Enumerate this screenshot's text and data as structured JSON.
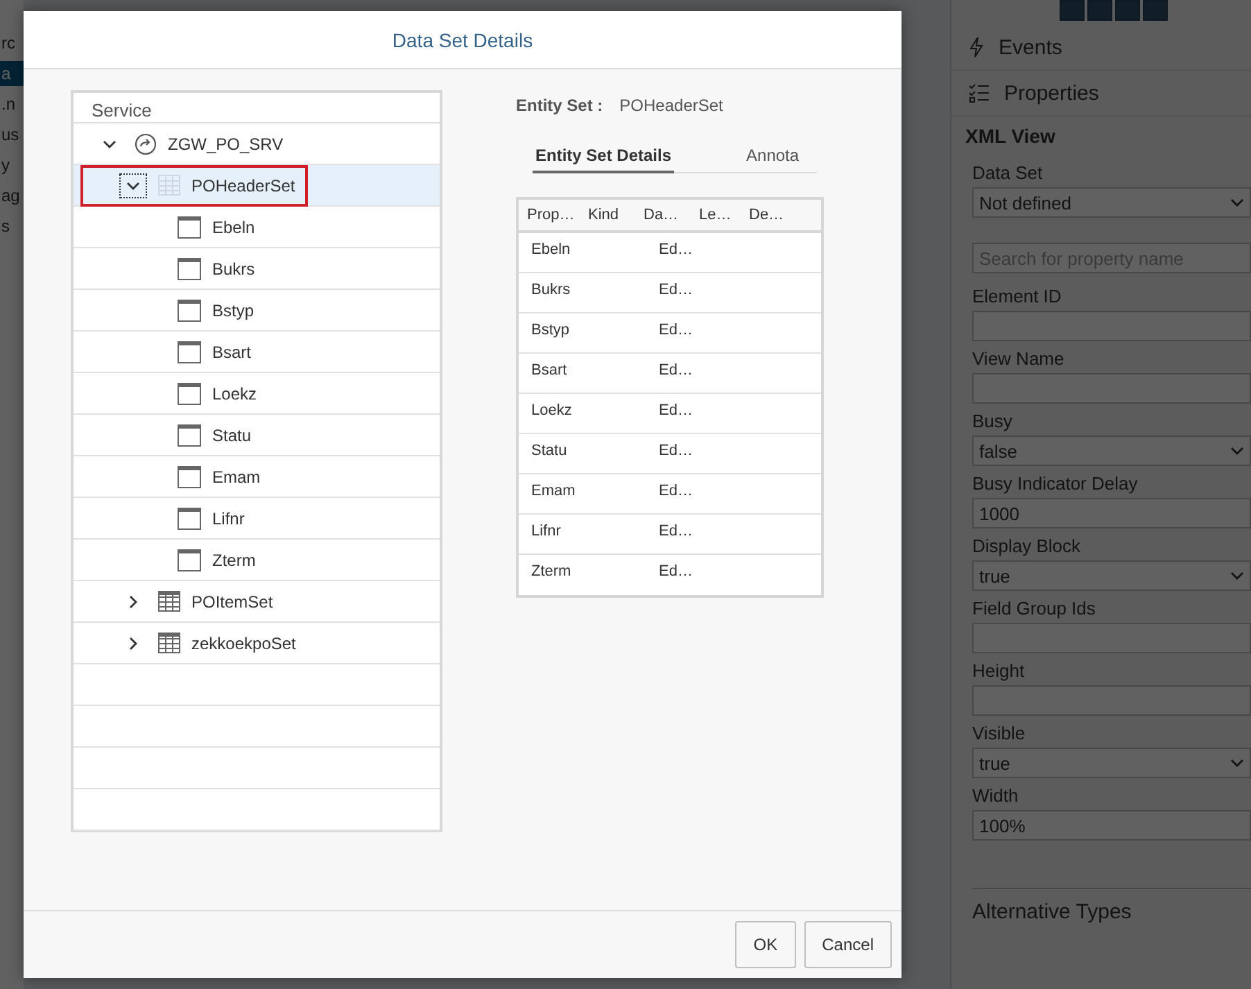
{
  "background": {
    "sidebar_fragments": [
      {
        "text": "rc",
        "selected": false
      },
      {
        "text": "a",
        "selected": true
      },
      {
        "text": ".n",
        "selected": false
      },
      {
        "text": "us",
        "selected": false
      },
      {
        "text": "y",
        "selected": false
      },
      {
        "text": "ag",
        "selected": false
      },
      {
        "text": "s",
        "selected": false
      }
    ],
    "panel": {
      "sections": [
        {
          "label": "Events",
          "kind": "events"
        },
        {
          "label": "Properties",
          "kind": "properties"
        }
      ],
      "heading": "XML View",
      "fields": [
        {
          "kind": "select",
          "label": "Data Set",
          "value": "Not defined"
        },
        {
          "kind": "search",
          "placeholder": "Search for property name"
        },
        {
          "kind": "input",
          "label": "Element ID"
        },
        {
          "kind": "input",
          "label": "View Name"
        },
        {
          "kind": "select",
          "label": "Busy",
          "value": "false"
        },
        {
          "kind": "input",
          "label": "Busy Indicator Delay",
          "value": "1000"
        },
        {
          "kind": "select",
          "label": "Display Block",
          "value": "true"
        },
        {
          "kind": "input",
          "label": "Field Group Ids"
        },
        {
          "kind": "input",
          "label": "Height"
        },
        {
          "kind": "select",
          "label": "Visible",
          "value": "true"
        },
        {
          "kind": "input",
          "label": "Width",
          "value": "100%"
        }
      ],
      "footer_section": "Alternative Types"
    }
  },
  "dialog": {
    "title": "Data Set Details",
    "tree": {
      "header": "Service",
      "nodes": [
        {
          "label": "ZGW_PO_SRV",
          "kind": "service",
          "expanded": true,
          "selected": false,
          "marked": false,
          "children": [
            {
              "label": "POHeaderSet",
              "kind": "entity_set",
              "expanded": true,
              "selected": true,
              "marked": true,
              "children": [
                {
                  "label": "Ebeln",
                  "kind": "property",
                  "selected": false,
                  "marked": false
                },
                {
                  "label": "Bukrs",
                  "kind": "property",
                  "selected": false,
                  "marked": false
                },
                {
                  "label": "Bstyp",
                  "kind": "property",
                  "selected": false,
                  "marked": false
                },
                {
                  "label": "Bsart",
                  "kind": "property",
                  "selected": false,
                  "marked": false
                },
                {
                  "label": "Loekz",
                  "kind": "property",
                  "selected": false,
                  "marked": false
                },
                {
                  "label": "Statu",
                  "kind": "property",
                  "selected": false,
                  "marked": false
                },
                {
                  "label": "Emam",
                  "kind": "property",
                  "selected": false,
                  "marked": false
                },
                {
                  "label": "Lifnr",
                  "kind": "property",
                  "selected": false,
                  "marked": false
                },
                {
                  "label": "Zterm",
                  "kind": "property",
                  "selected": false,
                  "marked": false
                }
              ]
            },
            {
              "label": "POItemSet",
              "kind": "entity_set",
              "expanded": false,
              "selected": false,
              "marked": false
            },
            {
              "label": "zekkoekpoSet",
              "kind": "entity_set",
              "expanded": false,
              "selected": false,
              "marked": false
            }
          ]
        }
      ]
    },
    "entity_set": {
      "label": "Entity Set :",
      "value": "POHeaderSet"
    },
    "tabs": [
      {
        "label": "Entity Set Details",
        "selected": true
      },
      {
        "label": "Annota",
        "selected": false
      }
    ],
    "table": {
      "columns": [
        "Prop…",
        "Kind",
        "Da…",
        "Le…",
        "De…"
      ],
      "rows": [
        {
          "column_1": "Ebeln",
          "column_3": "Ed…"
        },
        {
          "column_1": "Bukrs",
          "column_3": "Ed…"
        },
        {
          "column_1": "Bstyp",
          "column_3": "Ed…"
        },
        {
          "column_1": "Bsart",
          "column_3": "Ed…"
        },
        {
          "column_1": "Loekz",
          "column_3": "Ed…"
        },
        {
          "column_1": "Statu",
          "column_3": "Ed…"
        },
        {
          "column_1": "Emam",
          "column_3": "Ed…"
        },
        {
          "column_1": "Lifnr",
          "column_3": "Ed…"
        },
        {
          "column_1": "Zterm",
          "column_3": "Ed…"
        }
      ]
    },
    "buttons": [
      "OK",
      "Cancel"
    ]
  }
}
